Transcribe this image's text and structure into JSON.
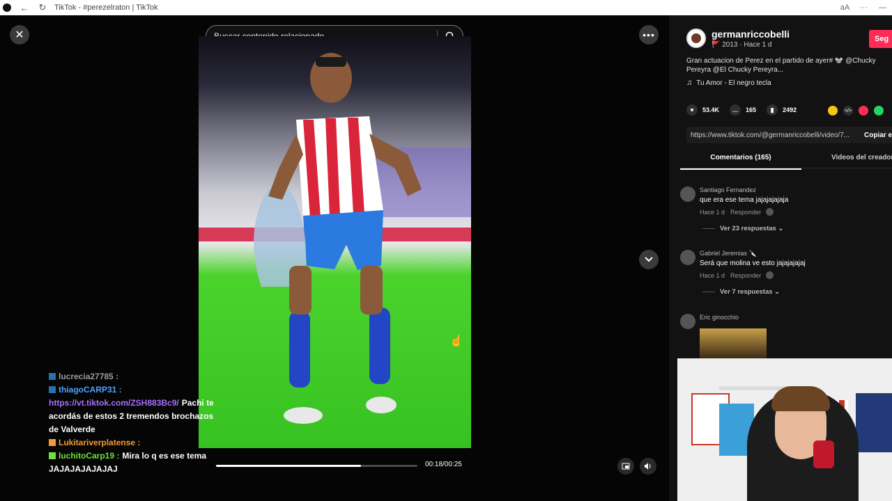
{
  "browser": {
    "title": "TikTok - #perezelraton | TikTok",
    "window_controls": [
      "aA",
      "···",
      "—"
    ]
  },
  "player": {
    "close_glyph": "✕",
    "search_placeholder": "Buscar contenido relacionado",
    "more_glyph": "•••",
    "time": "00:18/00:25",
    "progress_fraction": 0.72
  },
  "chat": [
    {
      "user": "lucrecia27785 :",
      "text": "",
      "user_color": "#9a9a9a",
      "text_color": "#ffffff",
      "badge_color": "#2a6fb0"
    },
    {
      "user": "thiagoCARP31 :",
      "text": "",
      "user_color": "#4fa3ff",
      "text_color": "#ffffff",
      "badge_color": "#2a6fb0"
    },
    {
      "user": "https://vt.tiktok.com/ZSH883Bc9/",
      "text": "Pachi te acordás de estos 2 tremendos brochazos de Valverde",
      "user_color": "#a970ff",
      "text_color": "#ffffff",
      "badge_color": ""
    },
    {
      "user": "Lukitariverplatense :",
      "text": "",
      "user_color": "#f29b38",
      "text_color": "#ffffff",
      "badge_color": "#f29b38"
    },
    {
      "user": "luchitoCarp19 :",
      "text": "Mira lo q es ese tema JAJAJAJAJAJAJ",
      "user_color": "#6ee03a",
      "text_color": "#ffffff",
      "badge_color": "#6ee03a"
    }
  ],
  "panel": {
    "author": {
      "name": "germanriccobelli",
      "meta": "🚩 2013 · Hace 1 d"
    },
    "follow_label": "Seg",
    "description": "Gran actuacion de Perez en el partido de ayer# 🐭 @Chucky Pereyra @El Chucky Pereyra...",
    "music": "Tu Amor - El negro tecla",
    "stats": {
      "likes": "53.4K",
      "comments": "165",
      "saves": "2492"
    },
    "link": "https://www.tiktok.com/@germanriccobelli/video/7...",
    "copy_label": "Copiar en",
    "tabs": {
      "comments": "Comentarios (165)",
      "creator_videos": "Videos del creador"
    },
    "comments": [
      {
        "user": "Santiago Fernandez",
        "text": "que era ese tema jajajajajaja",
        "time": "Hace 1 d",
        "reply": "Responder",
        "replies": "Ver 23 respuestas ⌄"
      },
      {
        "user": "Gabriel Jeremias 🔪",
        "text": "Será que molina ve esto jajajajajaj",
        "time": "Hace 1 d",
        "reply": "Responder",
        "replies": "Ver 7 respuestas ⌄"
      },
      {
        "user": "Eric ginocchio",
        "text": "",
        "time": "",
        "reply": "",
        "replies": ""
      }
    ]
  },
  "colors": {
    "accent": "#fe2c55",
    "panel_bg": "#121212"
  }
}
